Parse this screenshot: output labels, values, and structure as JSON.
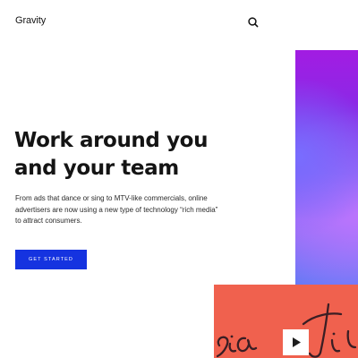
{
  "header": {
    "logo_text": "Gravity",
    "search_icon": "search-icon"
  },
  "hero": {
    "headline_lines": [
      "Work around you",
      "and your team"
    ],
    "description_lines": [
      "From ads that dance or sing to MTV-like commercials, online",
      "advertisers are now using a new type of technology “rich media”",
      "to attract consumers."
    ],
    "cta_label": "GET STARTED"
  },
  "media": {
    "play_icon": "play-icon"
  },
  "colors": {
    "accent": "#1533e0",
    "video_card": "#f0614e",
    "gradient": [
      "#a21ce2",
      "#7258f0",
      "#5a7af5"
    ],
    "text": "#141414"
  }
}
